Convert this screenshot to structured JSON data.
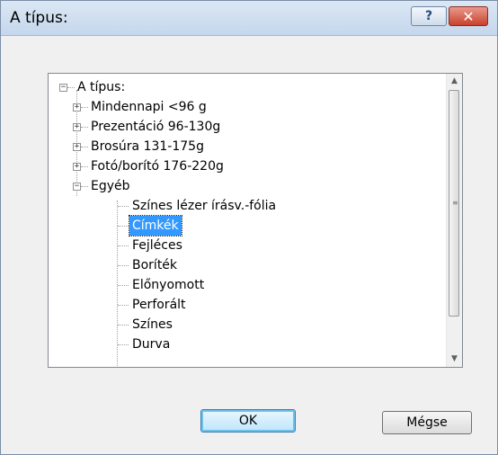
{
  "window": {
    "title": "A típus:",
    "help_label": "?",
    "close_label": "✕"
  },
  "tree": {
    "root_label": "A típus:",
    "items": [
      {
        "label": "Mindennapi <96 g",
        "expander": "+"
      },
      {
        "label": "Prezentáció 96-130g",
        "expander": "+"
      },
      {
        "label": "Brosúra 131-175g",
        "expander": "+"
      },
      {
        "label": "Fotó/borító 176-220g",
        "expander": "+"
      },
      {
        "label": "Egyéb",
        "expander": "−"
      }
    ],
    "children": [
      {
        "label": "Színes lézer írásv.-fólia"
      },
      {
        "label": "Címkék",
        "selected": true
      },
      {
        "label": "Fejléces"
      },
      {
        "label": "Boríték"
      },
      {
        "label": "Előnyomott"
      },
      {
        "label": "Perforált"
      },
      {
        "label": "Színes"
      },
      {
        "label": "Durva"
      }
    ]
  },
  "scrollbar": {
    "up_arrow": "▲",
    "down_arrow": "▼",
    "grip": "≡"
  },
  "buttons": {
    "ok_label": "OK",
    "cancel_label": "Mégse"
  },
  "colors": {
    "selection": "#3399ff",
    "titlebar": "#c5d7ed",
    "close": "#c9412d"
  }
}
